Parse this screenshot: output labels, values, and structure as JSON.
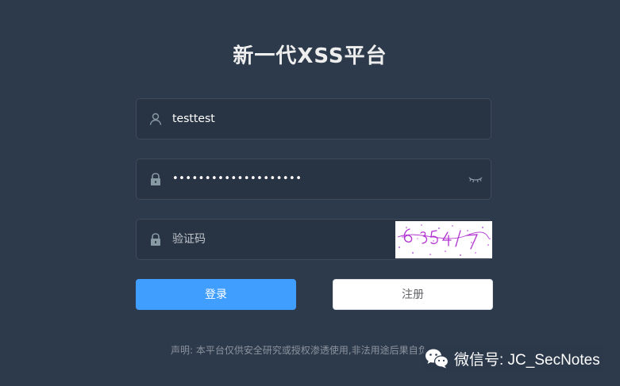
{
  "page": {
    "title": "新一代XSS平台"
  },
  "login_form": {
    "username": {
      "value": "testtest",
      "icon": "user-icon"
    },
    "password": {
      "value": "••••••••••••••••••••",
      "icon": "lock-icon",
      "toggle_icon": "eye-closed-icon"
    },
    "captcha": {
      "placeholder": "验证码",
      "icon": "lock-icon",
      "image_text": "6354/7"
    },
    "login_button": "登录",
    "register_button": "注册"
  },
  "footer": {
    "disclaimer": "声明: 本平台仅供安全研究或授权渗透使用,非法用途后果自负"
  },
  "watermark": {
    "text": "微信号: JC_SecNotes",
    "icon": "wechat-icon"
  },
  "colors": {
    "background": "#2d3a4b",
    "field_background": "#283443",
    "primary": "#409eff",
    "captcha_ink": "#b030d0"
  }
}
